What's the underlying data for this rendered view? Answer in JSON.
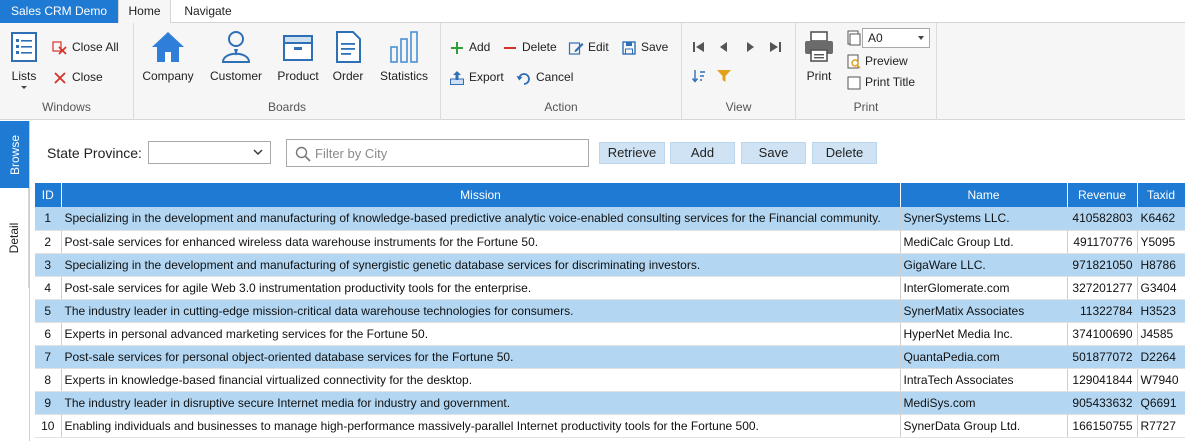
{
  "app": {
    "title": "Sales CRM Demo"
  },
  "ribbon_tabs": [
    {
      "label": "Home",
      "active": true
    },
    {
      "label": "Navigate",
      "active": false
    }
  ],
  "windows": {
    "group_label": "Windows",
    "lists_label": "Lists",
    "close_all_label": "Close All",
    "close_label": "Close"
  },
  "boards": {
    "group_label": "Boards",
    "company": "Company",
    "customer": "Customer",
    "product": "Product",
    "order": "Order",
    "statistics": "Statistics"
  },
  "action": {
    "group_label": "Action",
    "add": "Add",
    "delete": "Delete",
    "edit": "Edit",
    "save": "Save",
    "export": "Export",
    "cancel": "Cancel"
  },
  "view": {
    "group_label": "View"
  },
  "print": {
    "group_label": "Print",
    "print_label": "Print",
    "paper_size": "A0",
    "preview_label": "Preview",
    "print_title_label": "Print Title"
  },
  "side_tabs": {
    "browse": "Browse",
    "detail": "Detail"
  },
  "filter": {
    "state_label": "State Province:",
    "state_value": "",
    "city_placeholder": "Filter by City",
    "retrieve": "Retrieve",
    "add": "Add",
    "save": "Save",
    "delete": "Delete"
  },
  "table": {
    "columns": [
      "ID",
      "Mission",
      "Name",
      "Revenue",
      "Taxid"
    ],
    "rows": [
      {
        "id": "1",
        "mission": "Specializing in the development and manufacturing of knowledge-based predictive analytic voice-enabled consulting services for the Financial community.",
        "name": "SynerSystems LLC.",
        "revenue": "410582803",
        "taxid": "K6462"
      },
      {
        "id": "2",
        "mission": "Post-sale services for enhanced wireless data warehouse instruments for the Fortune 50.",
        "name": "MediCalc Group Ltd.",
        "revenue": "491170776",
        "taxid": "Y5095"
      },
      {
        "id": "3",
        "mission": "Specializing in the development and manufacturing of synergistic genetic database services for discriminating investors.",
        "name": "GigaWare LLC.",
        "revenue": "971821050",
        "taxid": "H8786"
      },
      {
        "id": "4",
        "mission": "Post-sale services for agile Web 3.0 instrumentation productivity tools for the enterprise.",
        "name": "InterGlomerate.com",
        "revenue": "327201277",
        "taxid": "G3404"
      },
      {
        "id": "5",
        "mission": "The industry leader in cutting-edge mission-critical data warehouse technologies for consumers.",
        "name": "SynerMatix Associates",
        "revenue": "11322784",
        "taxid": "H3523"
      },
      {
        "id": "6",
        "mission": "Experts in personal advanced marketing services for the Fortune 50.",
        "name": "HyperNet Media Inc.",
        "revenue": "374100690",
        "taxid": "J4585"
      },
      {
        "id": "7",
        "mission": "Post-sale services for personal object-oriented database services for the Fortune 50.",
        "name": "QuantaPedia.com",
        "revenue": "501877072",
        "taxid": "D2264"
      },
      {
        "id": "8",
        "mission": "Experts in knowledge-based financial virtualized connectivity for the desktop.",
        "name": "IntraTech Associates",
        "revenue": "129041844",
        "taxid": "W7940"
      },
      {
        "id": "9",
        "mission": "The industry leader in disruptive secure Internet media for industry and government.",
        "name": "MediSys.com",
        "revenue": "905433632",
        "taxid": "Q6691"
      },
      {
        "id": "10",
        "mission": "Enabling individuals and businesses to manage high-performance massively-parallel Internet productivity tools for the Fortune 500.",
        "name": "SynerData Group Ltd.",
        "revenue": "166150755",
        "taxid": "R7727"
      }
    ]
  },
  "colors": {
    "accent": "#1e7ad3",
    "row_alt": "#b3d7f3",
    "ribbon_bg": "#f6f6f6",
    "button_bg": "#cfe3f4",
    "add_green": "#2e9d3a",
    "delete_red": "#d8312a",
    "statistics_blue": "#4a8fd6",
    "home_icon_blue": "#2f7fd8"
  }
}
